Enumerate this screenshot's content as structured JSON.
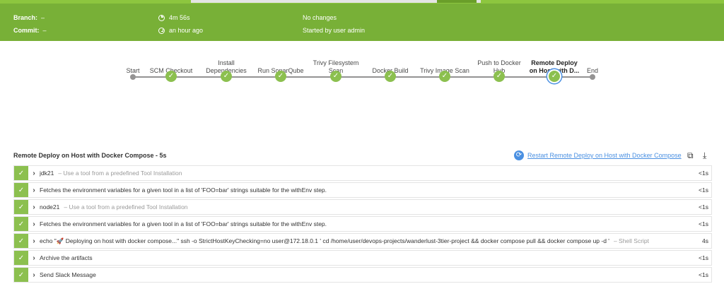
{
  "header": {
    "branch_label": "Branch:",
    "branch_value": "–",
    "commit_label": "Commit:",
    "commit_value": "–",
    "duration": "4m 56s",
    "started_ago": "an hour ago",
    "changes": "No changes",
    "started_by": "Started by user admin",
    "duration_icon": "timer-icon",
    "time_icon": "clock-icon"
  },
  "pipeline": {
    "stages": [
      {
        "label": "Start",
        "status": "start"
      },
      {
        "label": "SCM Checkout",
        "status": "success"
      },
      {
        "label": "Install\nDependencies",
        "status": "success"
      },
      {
        "label": "Run SonarQube",
        "status": "success"
      },
      {
        "label": "Trivy Filesystem\nScan",
        "status": "success"
      },
      {
        "label": "Docker Build",
        "status": "success"
      },
      {
        "label": "Trivy Image Scan",
        "status": "success"
      },
      {
        "label": "Push to Docker\nHub",
        "status": "success"
      },
      {
        "label": "Remote Deploy\non Host with D...",
        "status": "selected"
      },
      {
        "label": "End",
        "status": "end"
      }
    ]
  },
  "details": {
    "title": "Remote Deploy on Host with Docker Compose - 5s",
    "restart_label": "Restart Remote Deploy on Host with Docker Compose",
    "restart_icon": "restart-icon",
    "open_icon": "open-external-icon",
    "download_icon": "download-icon"
  },
  "steps": [
    {
      "text": "jdk21",
      "desc": "– Use a tool from a predefined Tool Installation",
      "time": "<1s"
    },
    {
      "text": "Fetches the environment variables for a given tool in a list of 'FOO=bar' strings suitable for the withEnv step.",
      "desc": "",
      "time": "<1s"
    },
    {
      "text": "node21",
      "desc": "– Use a tool from a predefined Tool Installation",
      "time": "<1s"
    },
    {
      "text": "Fetches the environment variables for a given tool in a list of 'FOO=bar' strings suitable for the withEnv step.",
      "desc": "",
      "time": "<1s"
    },
    {
      "text": "echo \"🚀 Deploying on host with docker compose...\" ssh -o StrictHostKeyChecking=no user@172.18.0.1 ' cd /home/user/devops-projects/wanderlust-3tier-project && docker compose pull && docker compose up -d '",
      "desc": "– Shell Script",
      "time": "4s"
    },
    {
      "text": "Archive the artifacts",
      "desc": "",
      "time": "<1s"
    },
    {
      "text": "Send Slack Message",
      "desc": "",
      "time": "<1s"
    }
  ],
  "colors": {
    "success": "#8cc04f",
    "header": "#78b037",
    "link": "#4a90e2"
  }
}
